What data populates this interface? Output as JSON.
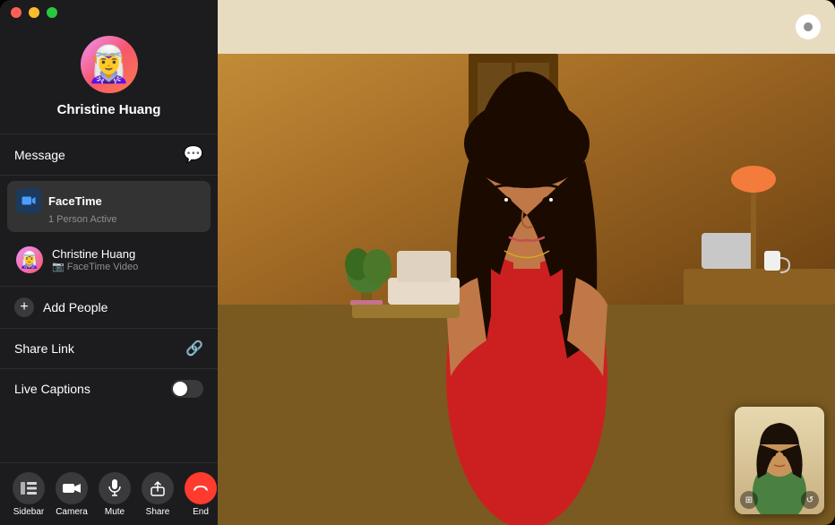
{
  "app": {
    "title": "FaceTime"
  },
  "sidebar": {
    "profile": {
      "name": "Christine Huang",
      "avatar_emoji": "🧝‍♀️"
    },
    "message_label": "Message",
    "facetime_section": {
      "title": "FaceTime",
      "subtitle": "1 Person Active",
      "participant": {
        "name": "Christine Huang",
        "status": "FaceTime Video",
        "avatar_emoji": "🧝‍♀️"
      }
    },
    "add_people_label": "Add People",
    "share_link_label": "Share Link",
    "live_captions_label": "Live Captions"
  },
  "toolbar": {
    "items": [
      {
        "id": "sidebar",
        "label": "Sidebar",
        "icon": "sidebar"
      },
      {
        "id": "camera",
        "label": "Camera",
        "icon": "camera"
      },
      {
        "id": "mute",
        "label": "Mute",
        "icon": "mic"
      },
      {
        "id": "share",
        "label": "Share",
        "icon": "share"
      },
      {
        "id": "end",
        "label": "End",
        "icon": "phone-end"
      }
    ]
  },
  "colors": {
    "accent_red": "#ff3b30",
    "sidebar_bg": "#1c1c1e",
    "toolbar_btn_bg": "#3a3a3c"
  }
}
